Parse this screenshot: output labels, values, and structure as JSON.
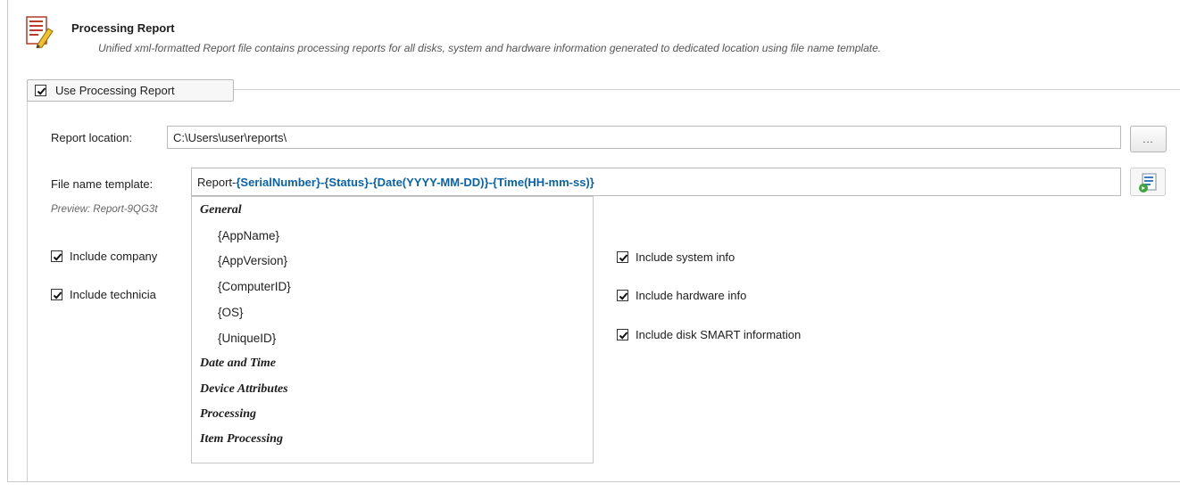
{
  "header": {
    "title": "Processing Report",
    "description": "Unified xml-formatted Report file contains processing reports for all disks, system and hardware information generated to dedicated location using file name template."
  },
  "group": {
    "use_report_label": "Use Processing Report",
    "use_report_checked": true
  },
  "report_location": {
    "label": "Report location:",
    "value": "C:\\Users\\user\\reports\\",
    "browse_label": "..."
  },
  "file_name_template": {
    "label": "File name template:",
    "prefix": "Report-",
    "tokens": [
      "{SerialNumber}",
      "-",
      "{Status}",
      "-",
      "{Date(YYYY-MM-DD)}",
      "-",
      "{Time(HH-mm-ss)}"
    ]
  },
  "preview_text": "Preview: Report-9QG3t",
  "options_left": [
    {
      "label": "Include company",
      "checked": true
    },
    {
      "label": "Include technicia",
      "checked": true
    }
  ],
  "options_right": [
    {
      "label": "Include system info",
      "checked": true
    },
    {
      "label": "Include hardware info",
      "checked": true
    },
    {
      "label": "Include disk SMART information",
      "checked": true
    }
  ],
  "macro_dropdown": {
    "groups": [
      {
        "label": "General",
        "items": [
          "{AppName}",
          "{AppVersion}",
          "{ComputerID}",
          "{OS}",
          "{UniqueID}"
        ]
      },
      {
        "label": "Date and Time",
        "items": []
      },
      {
        "label": "Device Attributes",
        "items": []
      },
      {
        "label": "Processing",
        "items": []
      },
      {
        "label": "Item Processing",
        "items": []
      }
    ]
  }
}
